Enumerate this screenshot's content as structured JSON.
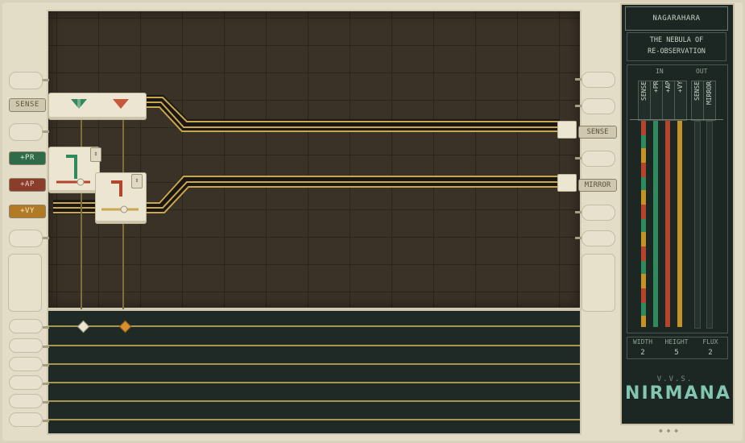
{
  "inputs": [
    {
      "label": "SENSE",
      "kind": "sense"
    },
    {
      "label": "+PR",
      "kind": "pr"
    },
    {
      "label": "+AP",
      "kind": "ap"
    },
    {
      "label": "+VY",
      "kind": "vy"
    }
  ],
  "outputs": [
    {
      "label": "SENSE"
    },
    {
      "label": "MIRROR"
    }
  ],
  "panel": {
    "location": "NAGARAHARA",
    "puzzle_line1": "THE NEBULA OF",
    "puzzle_line2": "RE-OBSERVATION",
    "in_header": "IN",
    "out_header": "OUT",
    "in_channels": [
      "SENSE",
      "+PR",
      "+AP",
      "+VY"
    ],
    "out_channels": [
      "SENSE",
      "MIRROR"
    ],
    "stats": [
      {
        "label": "WIDTH",
        "value": "2"
      },
      {
        "label": "HEIGHT",
        "value": "5"
      },
      {
        "label": "FLUX",
        "value": "2"
      }
    ],
    "logo_sub": "V.V.S.",
    "logo": "NIRMANA"
  },
  "colors": {
    "pr": "#2f8a5c",
    "ap": "#b5442d",
    "vy": "#c59225",
    "sense": "#b9b094",
    "wire": "#c9a650"
  }
}
